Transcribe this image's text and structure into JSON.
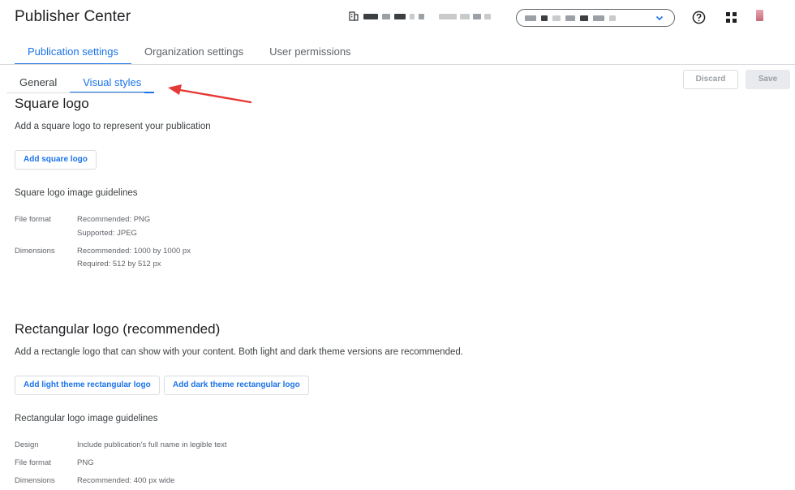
{
  "header": {
    "app_title": "Publisher Center",
    "building_icon": "building-icon",
    "help_icon": "help-circle-icon",
    "apps_icon": "apps-grid-icon"
  },
  "top_tabs": [
    {
      "label": "Publication settings",
      "active": true
    },
    {
      "label": "Organization settings",
      "active": false
    },
    {
      "label": "User permissions",
      "active": false
    }
  ],
  "sub_tabs": [
    {
      "label": "General",
      "active": false
    },
    {
      "label": "Visual styles",
      "active": true
    }
  ],
  "actions": {
    "discard_label": "Discard",
    "save_label": "Save"
  },
  "square_logo": {
    "title": "Square logo",
    "description": "Add a square logo to represent your publication",
    "button_label": "Add square logo",
    "guidelines_title": "Square logo image guidelines",
    "file_format_label": "File format",
    "file_format_recommended": "Recommended: PNG",
    "file_format_supported": "Supported: JPEG",
    "dimensions_label": "Dimensions",
    "dimensions_recommended": "Recommended: 1000 by 1000 px",
    "dimensions_required": "Required: 512 by 512 px"
  },
  "rect_logo": {
    "title": "Rectangular logo (recommended)",
    "description": "Add a rectangle logo that can show with your content. Both light and dark theme versions are recommended.",
    "light_button_label": "Add light theme rectangular logo",
    "dark_button_label": "Add dark theme rectangular logo",
    "guidelines_title": "Rectangular logo image guidelines",
    "design_label": "Design",
    "design_value": "Include publication's full name in legible text",
    "file_format_label": "File format",
    "file_format_value": "PNG",
    "dimensions_label": "Dimensions",
    "dimensions_value": "Recommended: 400 px wide"
  },
  "colors": {
    "accent": "#1a73e8",
    "arrow": "#e53935"
  }
}
